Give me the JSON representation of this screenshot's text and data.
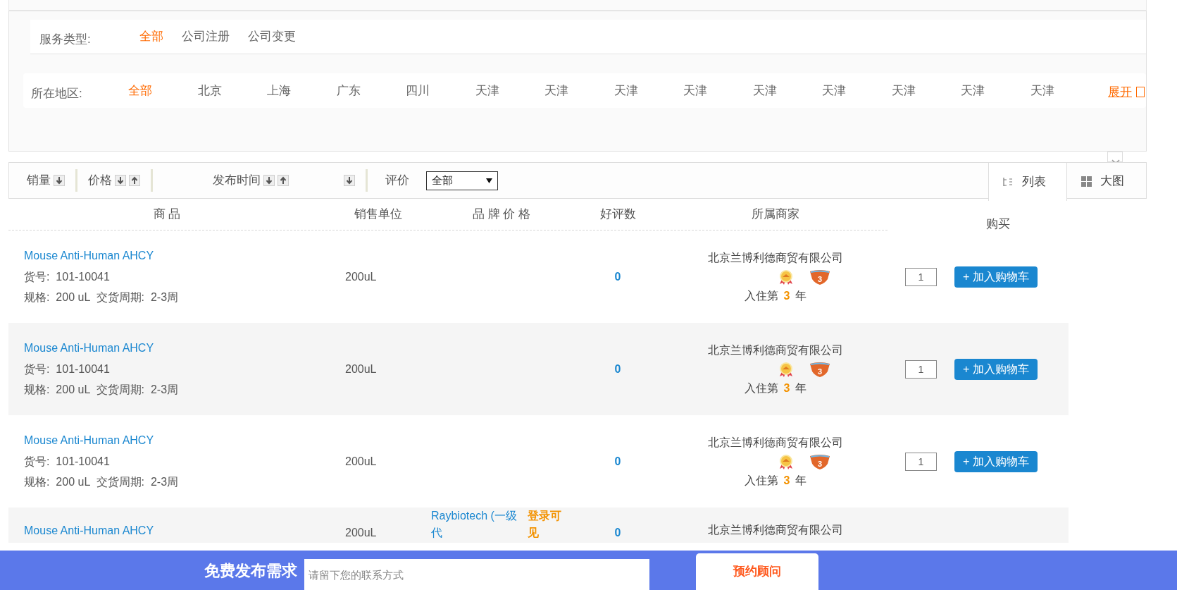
{
  "filters": [
    {
      "label": "服务类型:",
      "items": [
        {
          "text": "全部",
          "selected": true
        },
        {
          "text": "公司注册",
          "selected": false
        },
        {
          "text": "公司变更",
          "selected": false
        }
      ]
    },
    {
      "label": "所在地区:",
      "items": [
        {
          "text": "全部",
          "selected": true
        },
        {
          "text": "北京",
          "selected": false
        },
        {
          "text": "上海",
          "selected": false
        },
        {
          "text": "广东",
          "selected": false
        },
        {
          "text": "四川",
          "selected": false
        },
        {
          "text": "天津",
          "selected": false
        },
        {
          "text": "天津",
          "selected": false
        },
        {
          "text": "天津",
          "selected": false
        },
        {
          "text": "天津",
          "selected": false
        },
        {
          "text": "天津",
          "selected": false
        },
        {
          "text": "天津",
          "selected": false
        },
        {
          "text": "天津",
          "selected": false
        },
        {
          "text": "天津",
          "selected": false
        },
        {
          "text": "天津",
          "selected": false
        }
      ],
      "expand": "展开"
    }
  ],
  "sort_bar": {
    "items": [
      {
        "label": "销量",
        "sort_icons": [
          {
            "kind": "down"
          }
        ]
      },
      {
        "label": "价格",
        "sort_icons": [
          {
            "kind": "down"
          },
          {
            "kind": "up"
          }
        ]
      },
      {
        "label": "发布时间",
        "sort_icons": [
          {
            "kind": "down"
          },
          {
            "kind": "up"
          }
        ],
        "extra_icons": [
          {
            "kind": "down"
          }
        ]
      }
    ],
    "rating_label": "评价",
    "rating_value": "全部",
    "view_tabs": [
      {
        "label": "列表",
        "kind": "list",
        "selected": true
      },
      {
        "label": "大图",
        "kind": "grid",
        "selected": false
      }
    ]
  },
  "table": {
    "columns": [
      "商 品",
      "销售单位",
      "品 牌  价 格",
      "好评数",
      "所属商家"
    ],
    "buy_column": "购买",
    "rows": [
      {
        "title": "Mouse Anti-Human AHCY",
        "code_label": "货号:",
        "code": "101-10041",
        "spec_label": "规格:",
        "spec": "200 uL",
        "lead_label": "交货周期:",
        "lead": "2-3周",
        "unit": "200uL",
        "good": "0",
        "merchant": "北京兰博利德商贸有限公司",
        "badges": [
          {
            "kind": "medal"
          },
          {
            "kind": "shield",
            "text": "3"
          }
        ],
        "years_pre": "入住第",
        "years": "3",
        "years_post": "年",
        "qty": "1",
        "cart": "+ 加入购物车"
      },
      {
        "title": "Mouse Anti-Human AHCY",
        "code_label": "货号:",
        "code": "101-10041",
        "spec_label": "规格:",
        "spec": "200 uL",
        "lead_label": "交货周期:",
        "lead": "2-3周",
        "unit": "200uL",
        "good": "0",
        "merchant": "北京兰博利德商贸有限公司",
        "badges": [
          {
            "kind": "medal"
          },
          {
            "kind": "shield",
            "text": "3"
          }
        ],
        "years_pre": "入住第",
        "years": "3",
        "years_post": "年",
        "qty": "1",
        "cart": "+ 加入购物车"
      },
      {
        "title": "Mouse Anti-Human AHCY",
        "code_label": "货号:",
        "code": "101-10041",
        "spec_label": "规格:",
        "spec": "200 uL",
        "lead_label": "交货周期:",
        "lead": "2-3周",
        "unit": "200uL",
        "good": "0",
        "merchant": "北京兰博利德商贸有限公司",
        "badges": [
          {
            "kind": "medal"
          },
          {
            "kind": "shield",
            "text": "3"
          }
        ],
        "years_pre": "入住第",
        "years": "3",
        "years_post": "年",
        "qty": "1",
        "cart": "+ 加入购物车"
      },
      {
        "title": "Mouse Anti-Human AHCY",
        "unit": "200uL",
        "brand": "Raybiotech (一级代",
        "price": "登录可见",
        "good": "0",
        "merchant": "北京兰博利德商贸有限公司"
      }
    ]
  },
  "bottom_bar": {
    "title": "免费发布需求",
    "placeholder": "请留下您的联系方式",
    "button": "预约顾问"
  }
}
